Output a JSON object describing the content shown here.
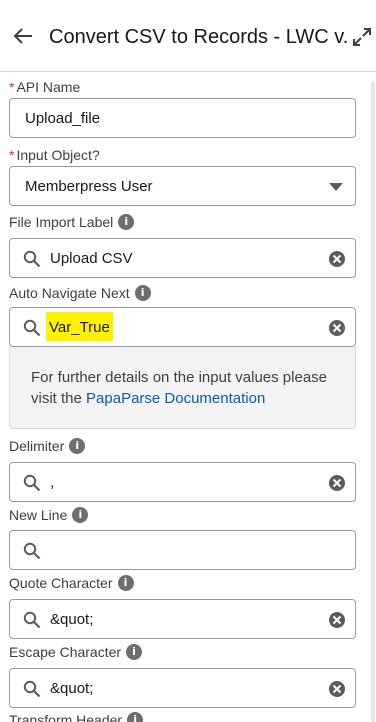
{
  "header": {
    "title": "Convert CSV to Records - LWC v..."
  },
  "fields": {
    "api_name": {
      "label": "API Name",
      "required": true,
      "value": "Upload_file"
    },
    "input_object": {
      "label": "Input Object?",
      "required": true,
      "value": "Memberpress User"
    },
    "file_import_label": {
      "label": "File Import Label",
      "value": "Upload CSV"
    },
    "auto_navigate_next": {
      "label": "Auto Navigate Next",
      "value": "Var_True"
    },
    "delimiter": {
      "label": "Delimiter",
      "value": ","
    },
    "new_line": {
      "label": "New Line",
      "value": ""
    },
    "quote_character": {
      "label": "Quote Character",
      "value": "&quot;"
    },
    "escape_character": {
      "label": "Escape Character",
      "value": "&quot;"
    },
    "transform_header": {
      "label": "Transform Header"
    }
  },
  "help": {
    "text_before": "For further details on the input values please visit the ",
    "link_text": "PapaParse Documentation"
  },
  "colors": {
    "highlight": "#fff200",
    "link": "#0b5cab",
    "required": "#c23934"
  }
}
